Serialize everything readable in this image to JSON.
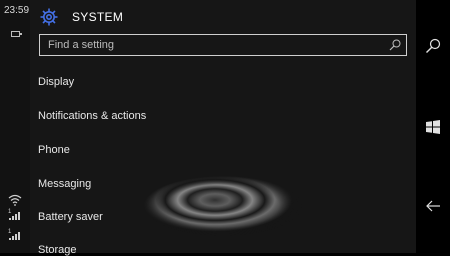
{
  "status": {
    "time": "23:59",
    "sim1": "1",
    "sim2": "1"
  },
  "header": {
    "title": "SYSTEM"
  },
  "search": {
    "placeholder": "Find a setting"
  },
  "menu": {
    "items": [
      {
        "label": "Display"
      },
      {
        "label": "Notifications & actions"
      },
      {
        "label": "Phone"
      },
      {
        "label": "Messaging"
      },
      {
        "label": "Battery saver"
      },
      {
        "label": "Storage"
      }
    ]
  },
  "nav": {
    "search_icon": "search-icon",
    "start_icon": "windows-logo-icon",
    "back_icon": "back-arrow-icon"
  },
  "colors": {
    "accent": "#3f6ee0",
    "background": "#161616",
    "statusbar": "#121212"
  }
}
